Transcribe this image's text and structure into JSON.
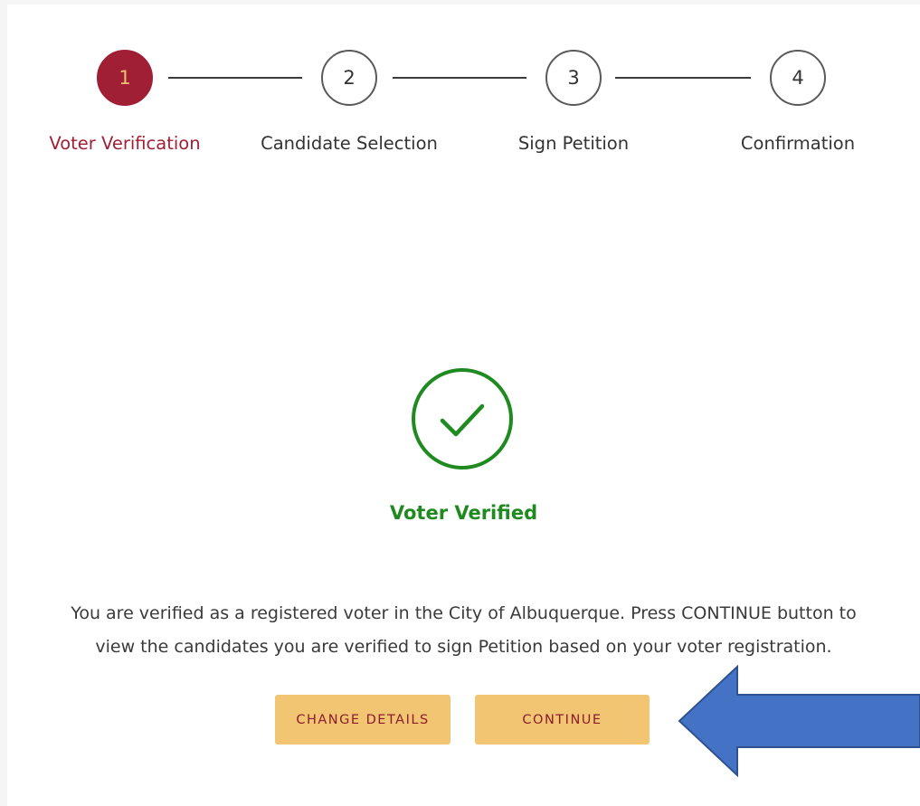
{
  "stepper": {
    "steps": [
      {
        "number": "1",
        "label": "Voter Verification",
        "active": true
      },
      {
        "number": "2",
        "label": "Candidate Selection",
        "active": false
      },
      {
        "number": "3",
        "label": "Sign Petition",
        "active": false
      },
      {
        "number": "4",
        "label": "Confirmation",
        "active": false
      }
    ]
  },
  "status": {
    "icon": "check-circle-icon",
    "title": "Voter Verified",
    "message_line1": "You are verified as a registered voter in the City of Albuquerque. Press CONTINUE button to",
    "message_line2": "view the candidates you are verified to sign Petition based on your voter registration."
  },
  "actions": {
    "change_details_label": "CHANGE DETAILS",
    "continue_label": "CONTINUE"
  },
  "annotation": {
    "icon": "arrow-left-icon"
  },
  "colors": {
    "accent": "#a01f35",
    "success": "#1f8a1f",
    "button_bg": "#f2c572",
    "button_text": "#8b1e2e",
    "arrow_fill": "#4472c4",
    "arrow_stroke": "#2f528f"
  }
}
